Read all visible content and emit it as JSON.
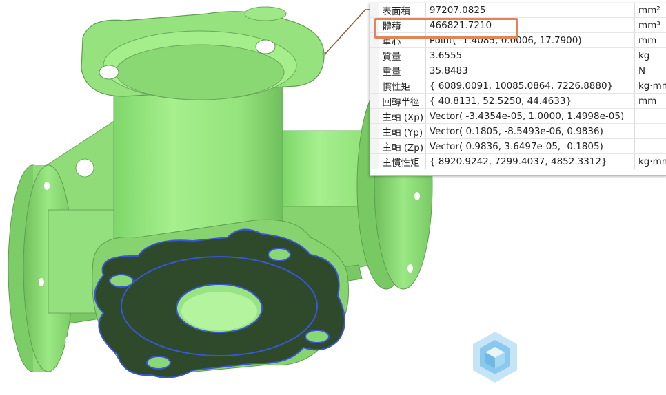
{
  "properties": {
    "rows": [
      {
        "label": "表面積",
        "value": "97207.0825",
        "unit": "mm²"
      },
      {
        "label": "體積",
        "value": "466821.7210",
        "unit": "mm³"
      },
      {
        "label": "重心",
        "value": "Point( -1.4085, 0.0006, 17.7900)",
        "unit": "mm"
      },
      {
        "label": "質量",
        "value": "3.6555",
        "unit": "kg"
      },
      {
        "label": "重量",
        "value": "35.8483",
        "unit": "N"
      },
      {
        "label": "慣性矩",
        "value": "{ 6089.0091, 10085.0864, 7226.8880}",
        "unit": "kg·mm"
      },
      {
        "label": "回轉半徑",
        "value": "{ 40.8131, 52.5250, 44.4633}",
        "unit": "mm"
      },
      {
        "label": "主軸 (Xp)",
        "value": "Vector( -3.4354e-05, 1.0000, 1.4998e-05)",
        "unit": ""
      },
      {
        "label": "主軸 (Yp)",
        "value": "Vector( 0.1805, -8.5493e-06, 0.9836)",
        "unit": ""
      },
      {
        "label": "主軸 (Zp)",
        "value": "Vector( 0.9836, 3.6497e-05, -0.1805)",
        "unit": ""
      },
      {
        "label": "主慣性矩",
        "value": "{ 8920.9242, 7299.4037, 4852.3312}",
        "unit": "kg·mm"
      }
    ],
    "highlighted_row": "體積"
  },
  "colors": {
    "part_body": "#92e27c",
    "part_shadow": "#6fbf5c",
    "selected_face": "#2f4a2b",
    "selected_edge": "#3a55d8",
    "highlight_box": "#e0855a",
    "leader_line": "#8a5a3a"
  },
  "watermark_icon": "cube-logo-icon"
}
